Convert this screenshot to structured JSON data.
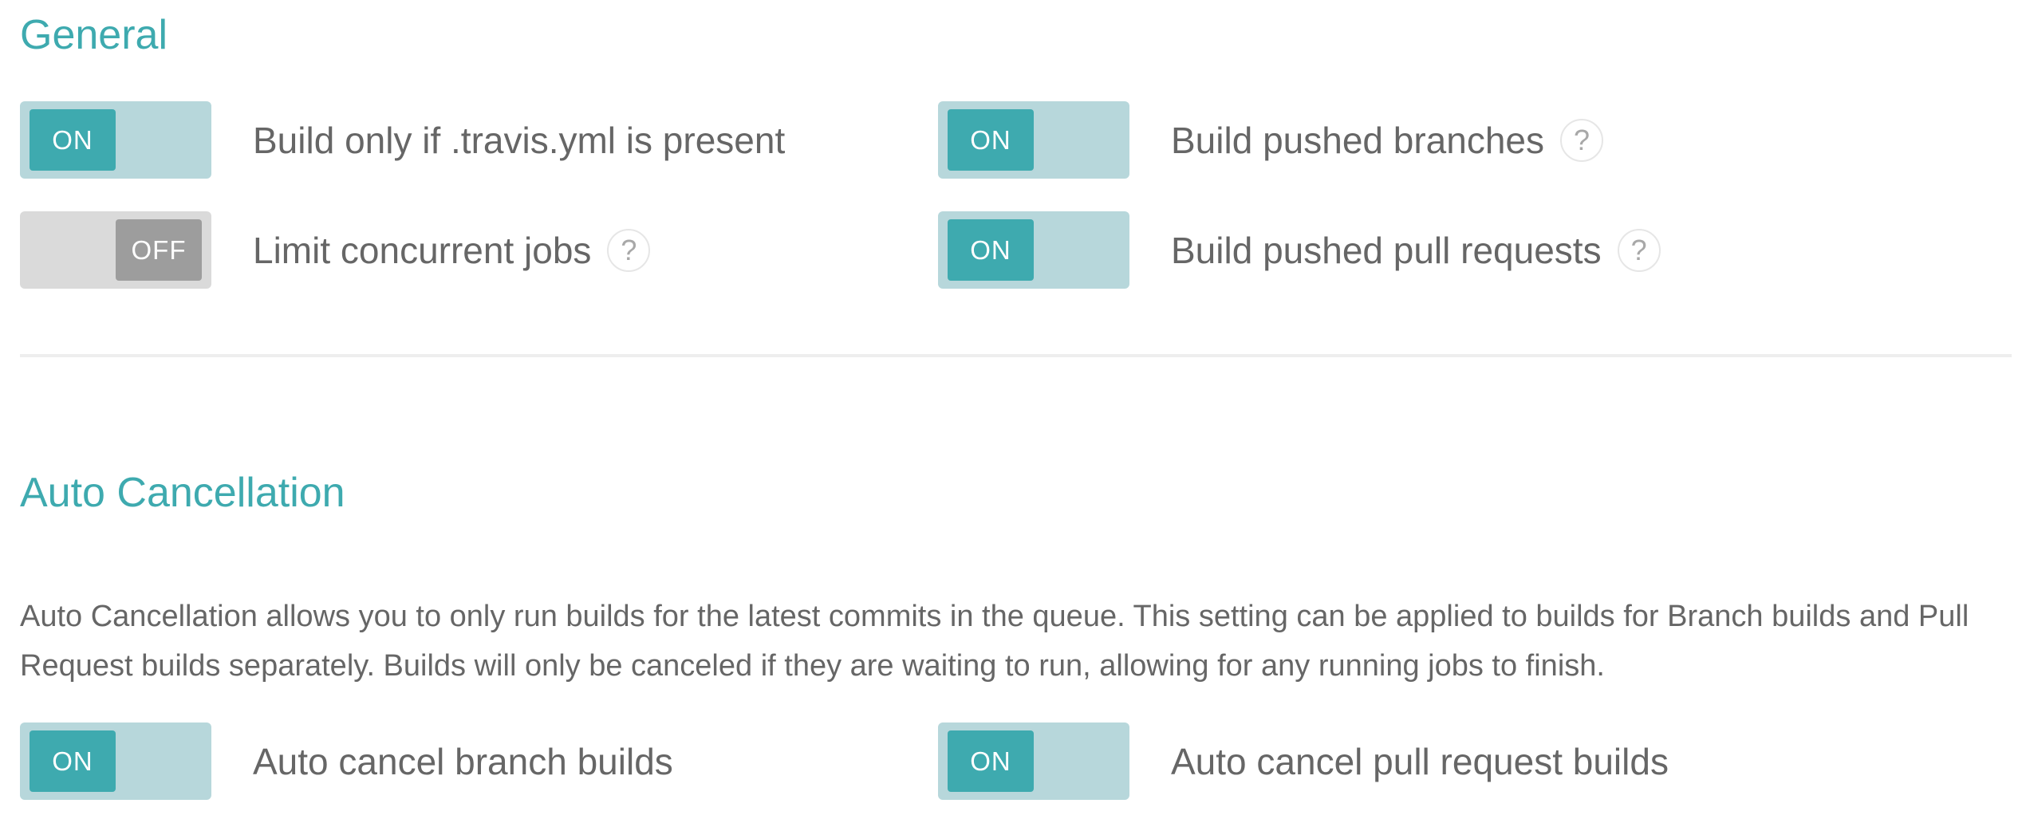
{
  "general": {
    "title": "General",
    "settings": [
      {
        "label": "Build only if .travis.yml is present",
        "state": "ON",
        "has_help": false
      },
      {
        "label": "Build pushed branches",
        "state": "ON",
        "has_help": true
      },
      {
        "label": "Limit concurrent jobs",
        "state": "OFF",
        "has_help": true
      },
      {
        "label": "Build pushed pull requests",
        "state": "ON",
        "has_help": true
      }
    ]
  },
  "auto_cancellation": {
    "title": "Auto Cancellation",
    "description": "Auto Cancellation allows you to only run builds for the latest commits in the queue. This setting can be applied to builds for Branch builds and Pull Request builds separately. Builds will only be canceled if they are waiting to run, allowing for any running jobs to finish.",
    "settings": [
      {
        "label": "Auto cancel branch builds",
        "state": "ON"
      },
      {
        "label": "Auto cancel pull request builds",
        "state": "ON"
      }
    ]
  },
  "help_glyph": "?",
  "icons": {
    "help": "question-circle-icon"
  },
  "colors": {
    "accent": "#3eaaaf",
    "toggle_on_track": "#b7d7db",
    "toggle_off_track": "#dadada",
    "toggle_off_knob": "#9d9d9d",
    "text": "#666666"
  }
}
